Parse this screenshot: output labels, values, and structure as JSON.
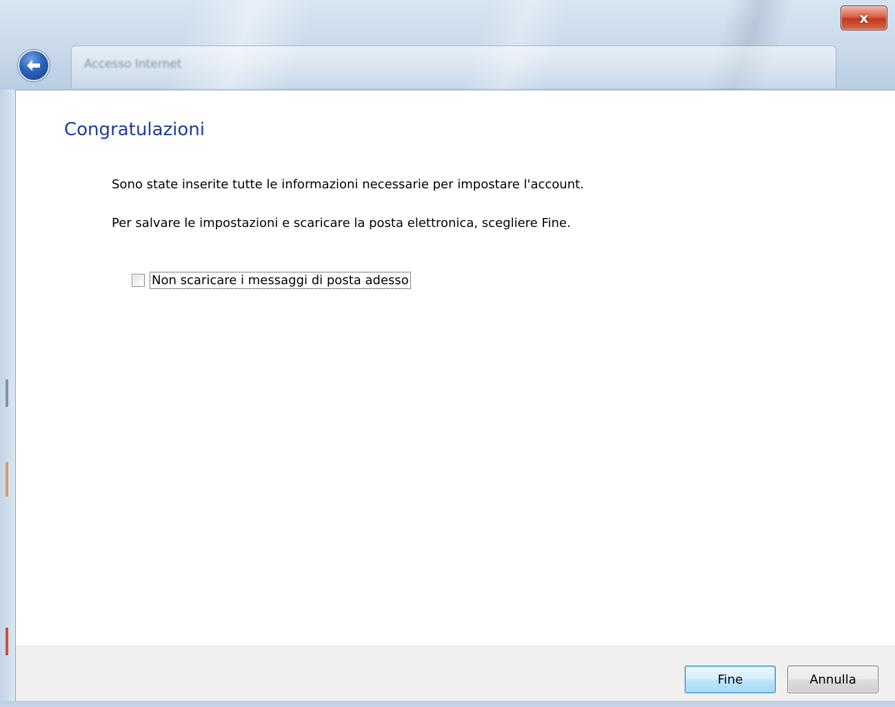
{
  "window": {
    "title": "Accesso Internet",
    "close_label": "x"
  },
  "content": {
    "heading": "Congratulazioni",
    "line1": "Sono state inserite tutte le informazioni necessarie per impostare l'account.",
    "line2": "Per salvare le impostazioni e scaricare la posta elettronica, scegliere Fine.",
    "checkbox": {
      "label": "Non scaricare i messaggi di posta adesso",
      "checked": false
    }
  },
  "footer": {
    "finish_label": "Fine",
    "cancel_label": "Annulla"
  },
  "colors": {
    "heading": "#1e3d9c",
    "close_button": "#c0391f",
    "default_button_border": "#3c7fb1"
  },
  "icons": {
    "back": "back-arrow-icon",
    "close": "close-icon"
  }
}
